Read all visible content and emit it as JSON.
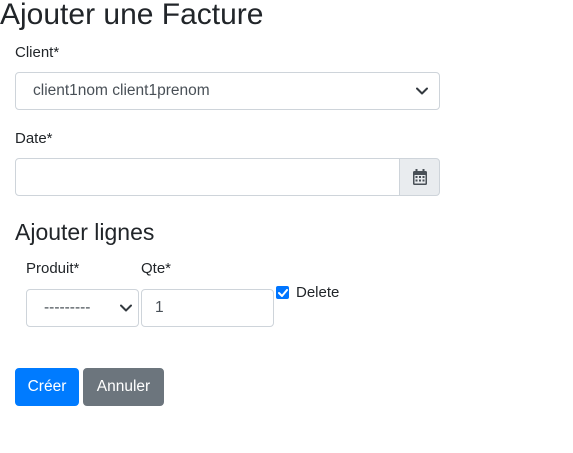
{
  "form": {
    "title": "Ajouter une Facture",
    "client_label": "Client*",
    "client_value": "client1nom client1prenom",
    "date_label": "Date*",
    "date_value": "",
    "calendar_icon": "calendar-icon"
  },
  "lines": {
    "title": "Ajouter lignes",
    "produit_label": "Produit*",
    "produit_value": "---------",
    "qte_label": "Qte*",
    "qte_value": "1",
    "delete_label": "Delete",
    "delete_checked": true
  },
  "actions": {
    "create_label": "Créer",
    "cancel_label": "Annuler"
  },
  "colors": {
    "primary": "#007bff",
    "secondary": "#6c757d",
    "checkbox": "#0075ff",
    "addon_bg": "#e9ecef",
    "border": "#ced4da"
  }
}
